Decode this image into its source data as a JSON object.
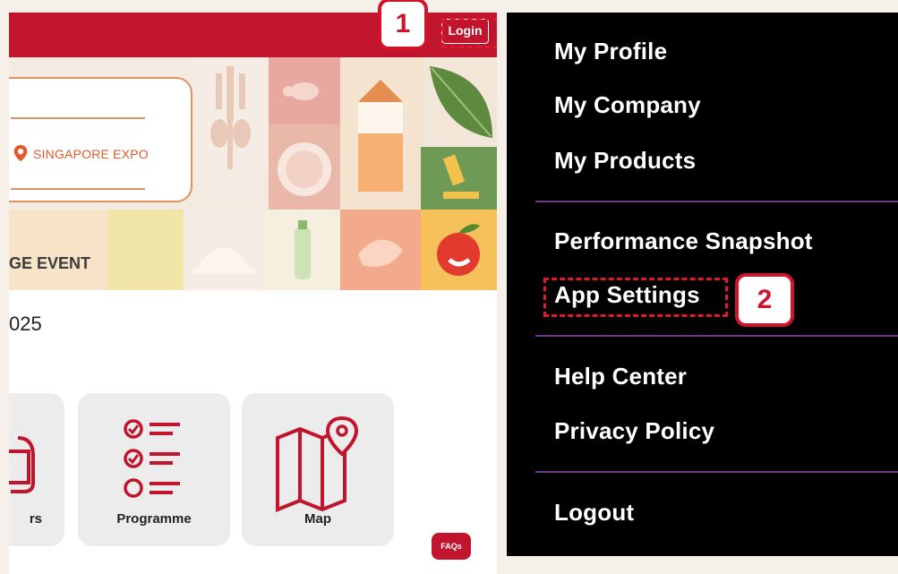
{
  "app": {
    "login_label": "Login",
    "step1_number": "1",
    "banner": {
      "venue": "SINGAPORE EXPO",
      "event_label": "GE EVENT"
    },
    "date_fragment": "025",
    "quick_links": [
      {
        "label": "rs"
      },
      {
        "label": "Programme"
      },
      {
        "label": "Map"
      }
    ],
    "faqs_label": "FAQs"
  },
  "menu": {
    "items": [
      {
        "label": "My Profile"
      },
      {
        "label": "My Company"
      },
      {
        "label": "My Products"
      },
      {
        "label": "Performance Snapshot"
      },
      {
        "label": "App Settings"
      },
      {
        "label": "Help Center"
      },
      {
        "label": "Privacy Policy"
      },
      {
        "label": "Logout"
      }
    ],
    "step2_number": "2"
  },
  "colors": {
    "brand_red": "#c0152d",
    "highlight_red": "#d0152b",
    "menu_bg": "#000000",
    "divider_purple": "#6a3a86"
  }
}
